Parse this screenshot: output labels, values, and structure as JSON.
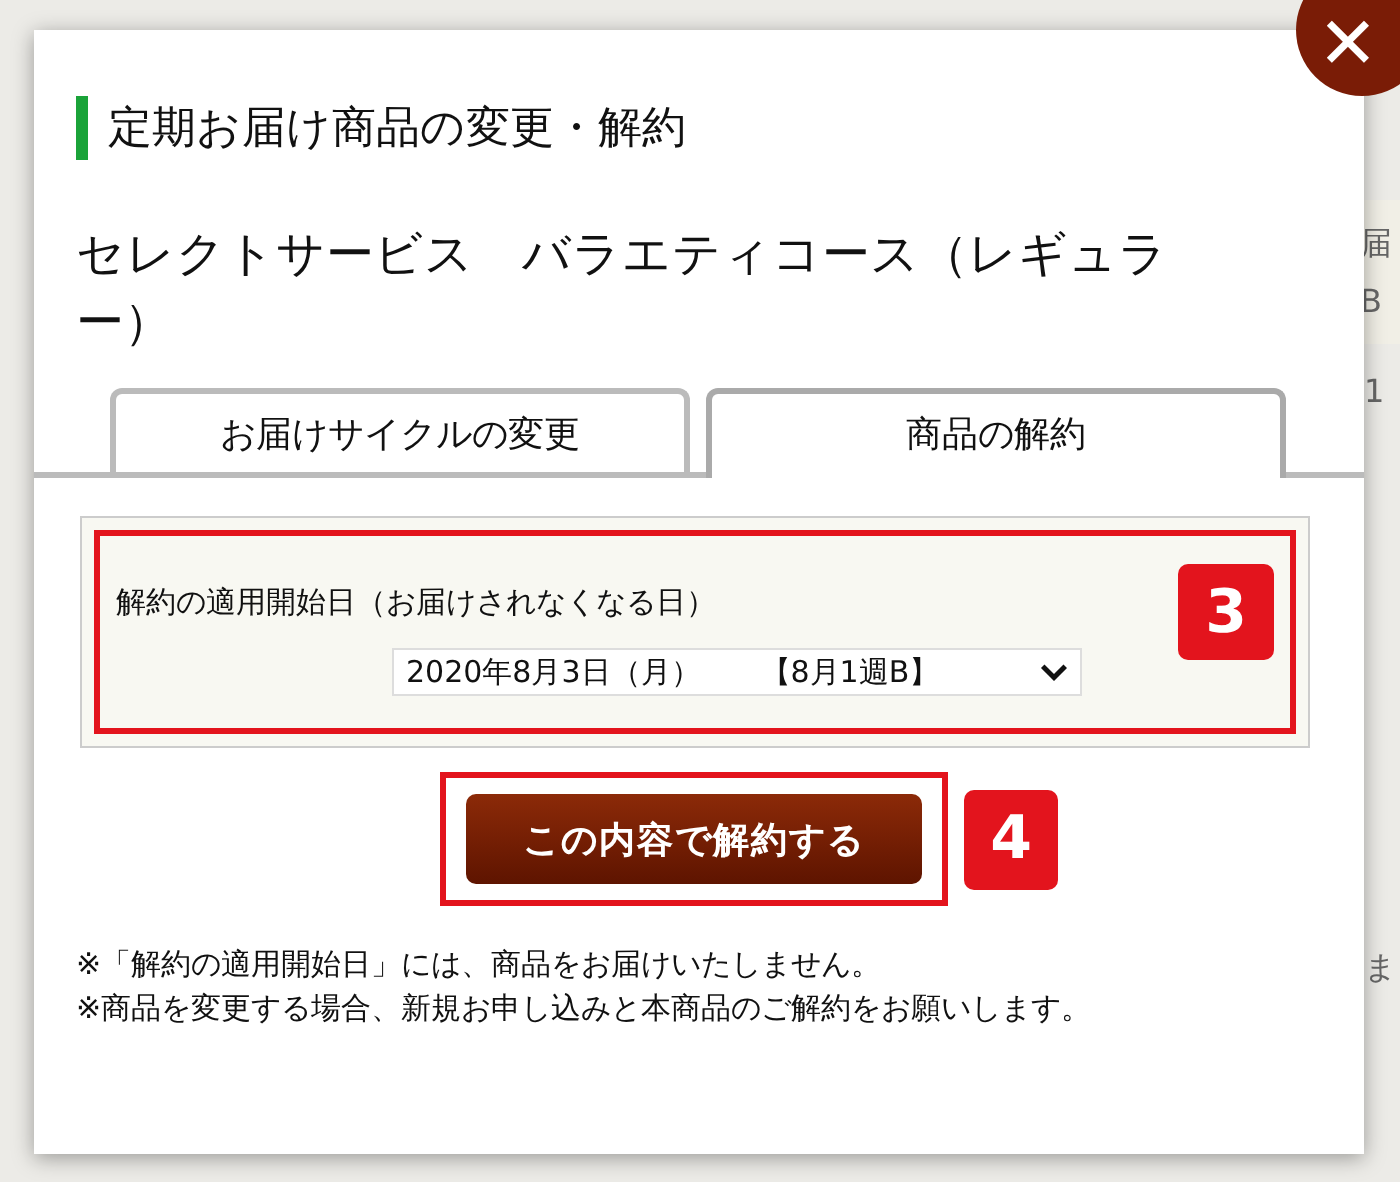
{
  "background": {
    "fragments": [
      {
        "kind": "boxed",
        "text": "届"
      },
      {
        "kind": "boxed",
        "text": "B"
      },
      {
        "kind": "plain",
        "text": "1"
      },
      {
        "kind": "plain",
        "text": "ま"
      }
    ]
  },
  "dialog": {
    "close_label": "✕",
    "title": "定期お届け商品の変更・解約",
    "product": "セレクトサービス　バラエティコース（レギュラー）",
    "tabs": [
      {
        "label": "お届けサイクルの変更",
        "selected": false
      },
      {
        "label": "商品の解約",
        "selected": true
      }
    ],
    "form": {
      "label": "解約の適用開始日（お届けされなくなる日）",
      "select_value": "2020年8月3日（月）　　【8月1週B】",
      "annotation": "3"
    },
    "submit": {
      "label": "この内容で解約する",
      "annotation": "4"
    },
    "notes": [
      "※「解約の適用開始日」には、商品をお届けいたしません。",
      "※商品を変更する場合、新規お申し込みと本商品のご解約をお願いします。"
    ]
  }
}
